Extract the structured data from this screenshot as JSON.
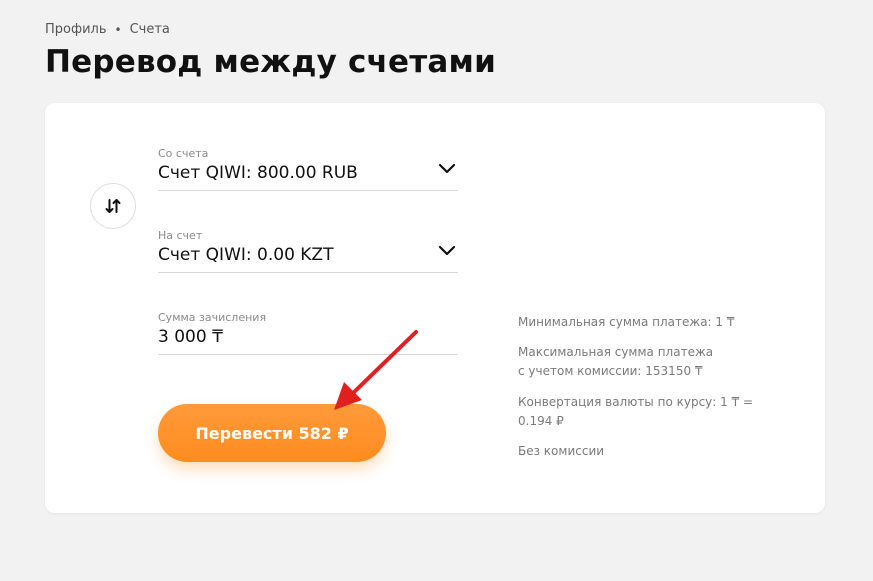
{
  "breadcrumb": {
    "items": [
      "Профиль",
      "Счета"
    ],
    "separator": "•"
  },
  "page": {
    "title": "Перевод между счетами"
  },
  "form": {
    "from": {
      "label": "Со счета",
      "value": "Счет QIWI: 800.00 RUB"
    },
    "to": {
      "label": "На счет",
      "value": "Счет QIWI: 0.00 KZT"
    },
    "amount": {
      "label": "Сумма зачисления",
      "value": "3 000 ₸"
    },
    "submit_label": "Перевести 582 ₽"
  },
  "info": {
    "min": "Минимальная сумма платежа: 1 ₸",
    "max_line1": "Максимальная сумма платежа",
    "max_line2": "с учетом комиссии: 153150 ₸",
    "conv_line1": "Конвертация валюты по курсу: 1 ₸ =",
    "conv_line2": "0.194 ₽",
    "fee": "Без комиссии"
  },
  "icons": {
    "swap": "swap-vertical-icon",
    "dropdown": "chevron-down-icon",
    "annotation": "red-arrow-annotation"
  },
  "colors": {
    "accent": "#ff8c1f",
    "annotation": "#e02020"
  }
}
